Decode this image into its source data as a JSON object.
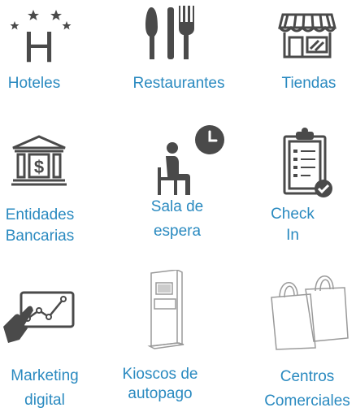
{
  "colors": {
    "label": "#2a8ac0",
    "icon_dark": "#4a4a4a",
    "icon_light": "#9a9a9a",
    "background": "#ffffff"
  },
  "tiles": [
    {
      "icon": "hotel-icon",
      "lines": [
        "Hoteles"
      ]
    },
    {
      "icon": "restaurant-icon",
      "lines": [
        "Restaurantes"
      ]
    },
    {
      "icon": "store-icon",
      "lines": [
        "Tiendas"
      ]
    },
    {
      "icon": "bank-icon",
      "lines": [
        "Entidades",
        "Bancarias"
      ]
    },
    {
      "icon": "waiting-room-icon",
      "lines": [
        "Sala de",
        "espera"
      ]
    },
    {
      "icon": "checklist-icon",
      "lines": [
        "Check",
        "In"
      ]
    },
    {
      "icon": "digital-marketing-icon",
      "lines": [
        "Marketing",
        "digital"
      ]
    },
    {
      "icon": "self-service-kiosk-icon",
      "lines": [
        "Kioscos de",
        "autopago"
      ]
    },
    {
      "icon": "shopping-bags-icon",
      "lines": [
        "Centros",
        "Comerciales"
      ]
    }
  ]
}
